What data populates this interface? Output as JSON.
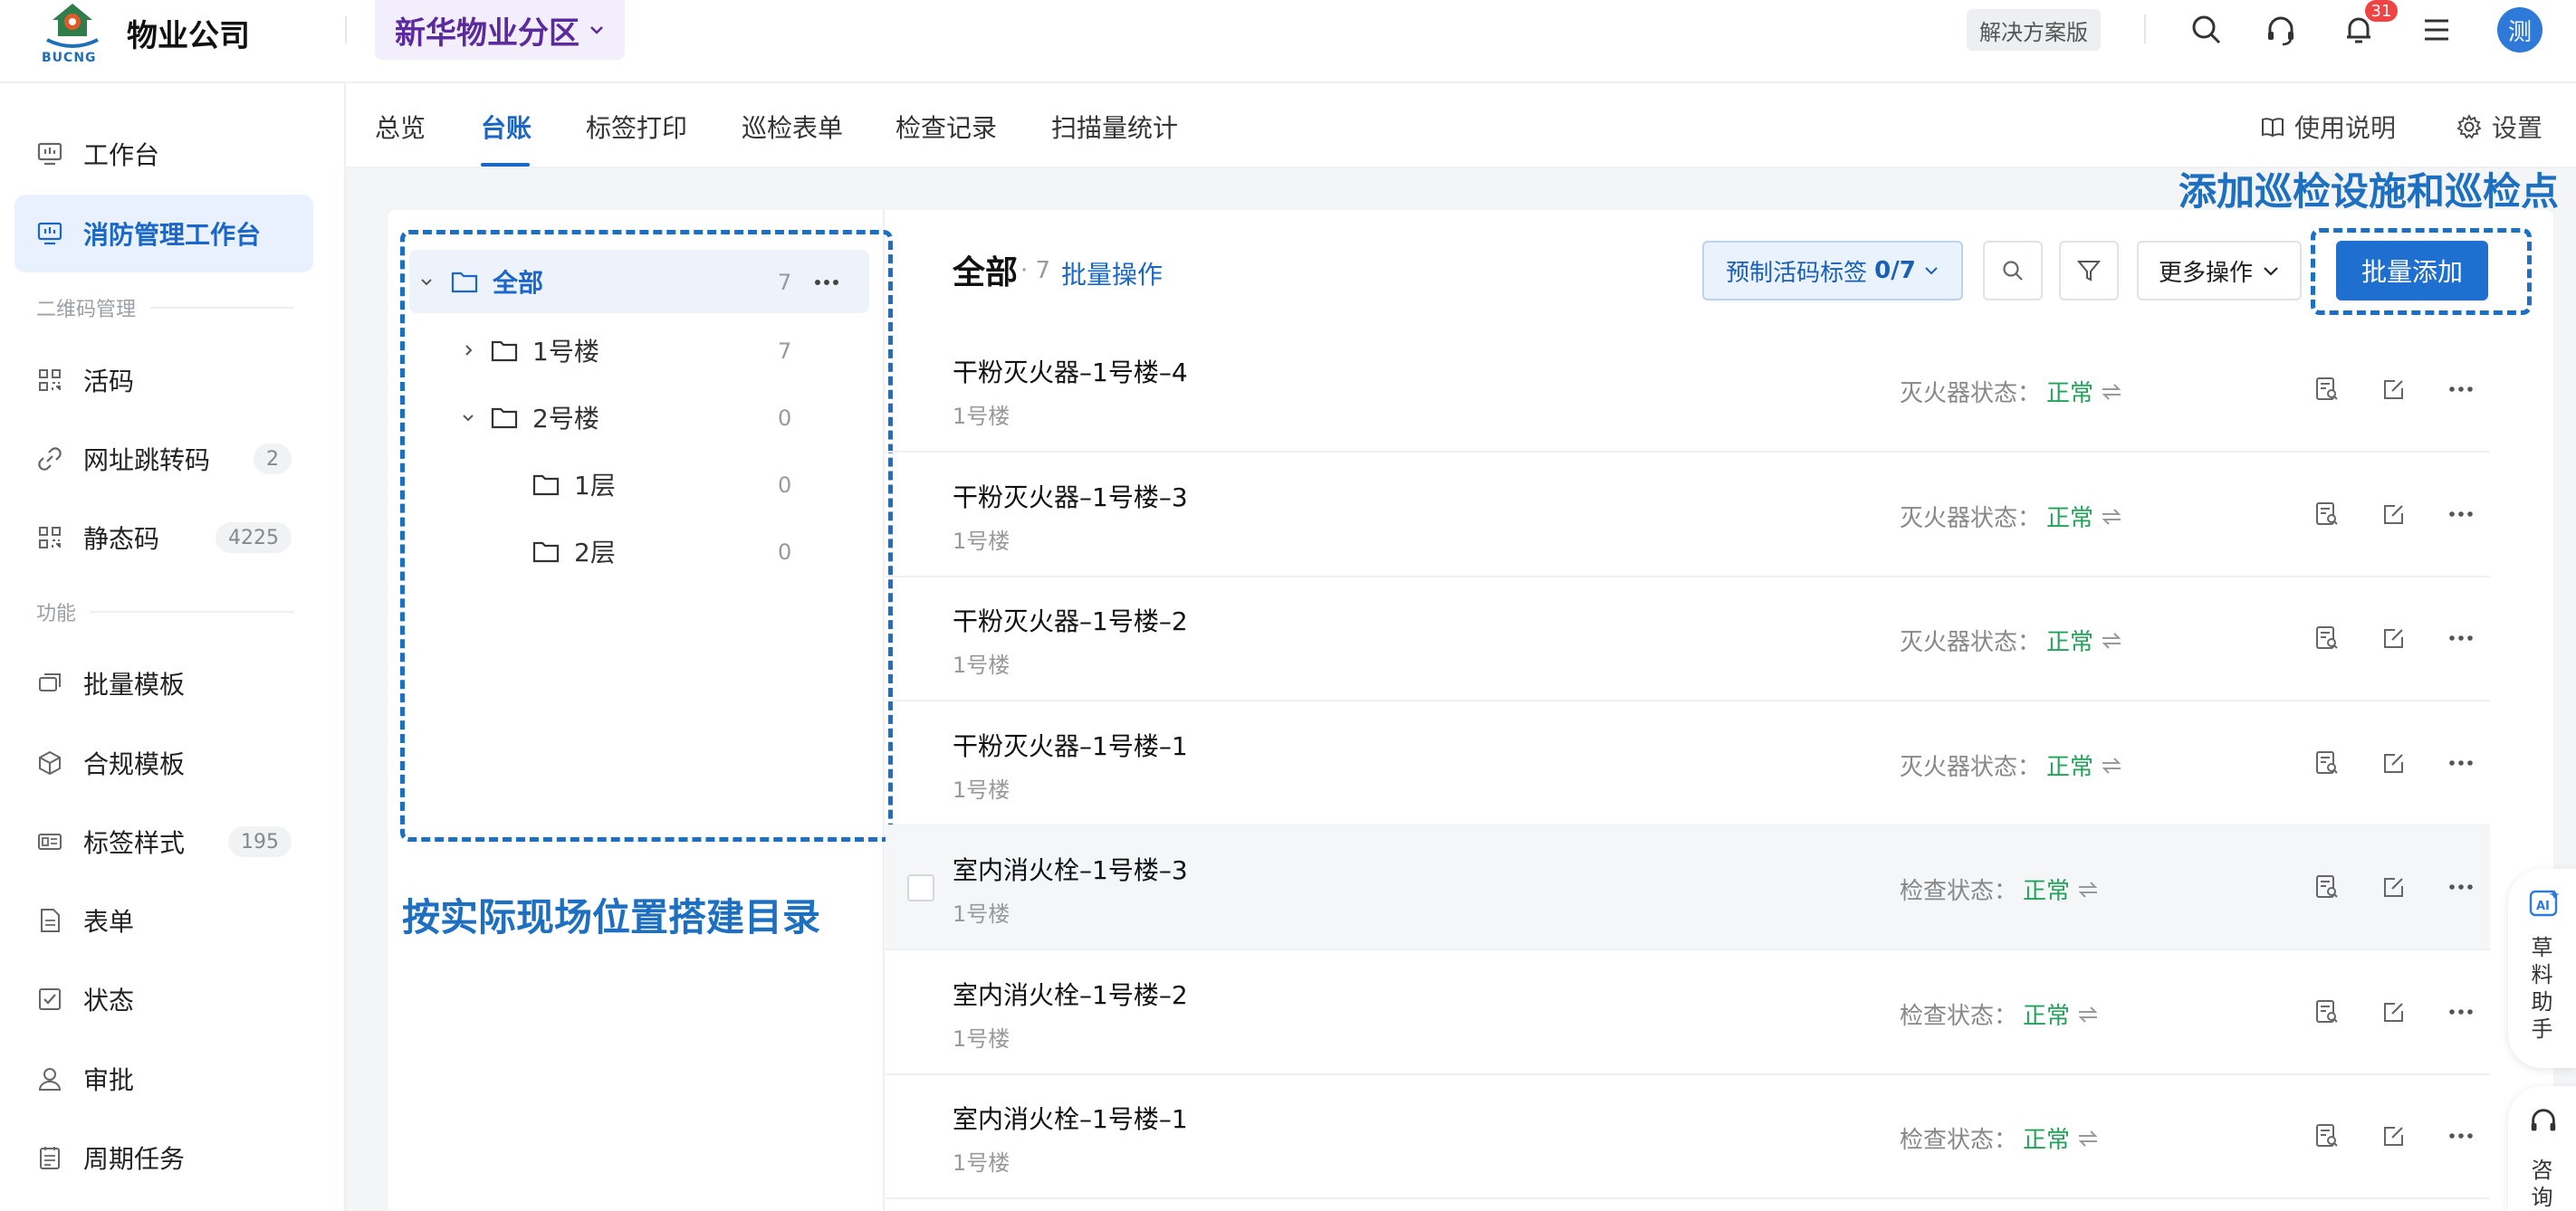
{
  "header": {
    "logo_text": "BUCNG",
    "company": "物业公司",
    "branch": "新华物业分区",
    "plan_badge": "解决方案版",
    "notifications": "31",
    "avatar": "测"
  },
  "sidebar": {
    "items": [
      {
        "label": "工作台",
        "icon": "monitor-icon"
      },
      {
        "label": "消防管理工作台",
        "icon": "monitor-icon",
        "active": true
      }
    ],
    "section_qr": "二维码管理",
    "qr_items": [
      {
        "label": "活码",
        "icon": "qr-icon",
        "count": ""
      },
      {
        "label": "网址跳转码",
        "icon": "link-icon",
        "count": "2"
      },
      {
        "label": "静态码",
        "icon": "qr-icon",
        "count": "4225"
      }
    ],
    "section_func": "功能",
    "func_items": [
      {
        "label": "批量模板",
        "icon": "template-icon",
        "count": ""
      },
      {
        "label": "合规模板",
        "icon": "cube-icon",
        "count": ""
      },
      {
        "label": "标签样式",
        "icon": "tag-icon",
        "count": "195"
      },
      {
        "label": "表单",
        "icon": "form-icon",
        "count": ""
      },
      {
        "label": "状态",
        "icon": "check-icon",
        "count": ""
      },
      {
        "label": "审批",
        "icon": "user-icon",
        "count": ""
      },
      {
        "label": "周期任务",
        "icon": "task-icon",
        "count": ""
      }
    ]
  },
  "tabs": {
    "items": [
      "总览",
      "台账",
      "标签打印",
      "巡检表单",
      "检查记录",
      "扫描量统计"
    ],
    "active": "台账",
    "help": "使用说明",
    "settings": "设置"
  },
  "tree": {
    "nodes": [
      {
        "label": "全部",
        "count": "7"
      },
      {
        "label": "1号楼",
        "count": "7"
      },
      {
        "label": "2号楼",
        "count": "0"
      },
      {
        "label": "1层",
        "count": "0"
      },
      {
        "label": "2层",
        "count": "0"
      }
    ]
  },
  "annotations": {
    "left": "按实际现场位置搭建目录",
    "right": "添加巡检设施和巡检点"
  },
  "list": {
    "title": "全部",
    "count": "· 7",
    "batch_link": "批量操作",
    "preset_label": "预制活码标签",
    "preset_value": "0/7",
    "more_ops": "更多操作",
    "add_button": "批量添加",
    "rows": [
      {
        "title": "干粉灭火器–1号楼–4",
        "sub": "1号楼",
        "status_label": "灭火器状态：",
        "status_value": "正常"
      },
      {
        "title": "干粉灭火器–1号楼–3",
        "sub": "1号楼",
        "status_label": "灭火器状态：",
        "status_value": "正常"
      },
      {
        "title": "干粉灭火器–1号楼–2",
        "sub": "1号楼",
        "status_label": "灭火器状态：",
        "status_value": "正常"
      },
      {
        "title": "干粉灭火器–1号楼–1",
        "sub": "1号楼",
        "status_label": "灭火器状态：",
        "status_value": "正常"
      },
      {
        "title": "室内消火栓–1号楼–3",
        "sub": "1号楼",
        "status_label": "检查状态：",
        "status_value": "正常"
      },
      {
        "title": "室内消火栓–1号楼–2",
        "sub": "1号楼",
        "status_label": "检查状态：",
        "status_value": "正常"
      },
      {
        "title": "室内消火栓–1号楼–1",
        "sub": "1号楼",
        "status_label": "检查状态：",
        "status_value": "正常"
      }
    ]
  },
  "float": {
    "ai_label": "AI",
    "assistant_chars": [
      "草",
      "料",
      "助",
      "手"
    ],
    "consult_chars": [
      "咨",
      "询"
    ]
  },
  "colors": {
    "primary": "#1f6fd1",
    "annotation": "#1d6fc2",
    "ok": "#22a35a",
    "branch": "#5b2a9e"
  }
}
